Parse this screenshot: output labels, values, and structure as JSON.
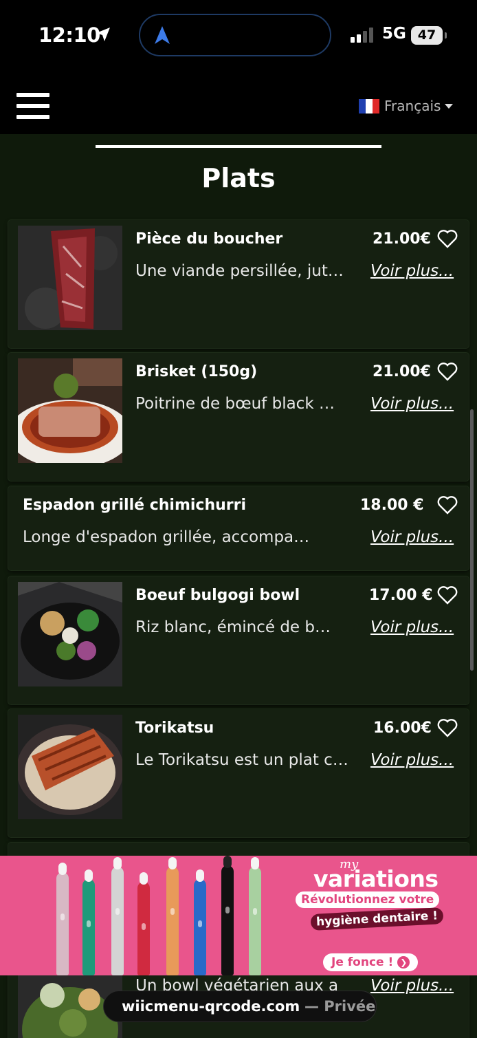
{
  "status_bar": {
    "time": "12:10",
    "network": "5G",
    "battery": "47"
  },
  "nav": {
    "language": "Français"
  },
  "section": {
    "title": "Plats"
  },
  "items": [
    {
      "name": "Pièce du boucher",
      "description": "Une viande persillée, juteuse et tendre",
      "price": "21.00€",
      "more": "Voir plus..."
    },
    {
      "name": "Brisket (150g)",
      "description": "Poitrine de bœuf black Angus fumée",
      "price": "21.00€",
      "more": "Voir plus..."
    },
    {
      "name": "Espadon grillé chimichurri",
      "description": "Longe d'espadon grillée, accompagnée de sauce chimichurri",
      "price": "18.00 €",
      "more": "Voir plus..."
    },
    {
      "name": "Boeuf bulgogi bowl",
      "description": "Riz blanc, émincé de bœuf mariné",
      "price": "17.00 €",
      "more": "Voir plus..."
    },
    {
      "name": "Torikatsu",
      "description": "Le Torikatsu est un plat croustillant",
      "price": "16.00€",
      "more": "Voir plus..."
    },
    {
      "description": "Un bowl végétarien aux a",
      "more": "Voir plus..."
    }
  ],
  "ad": {
    "brand_top": "my",
    "brand": "variations",
    "line1": "Révolutionnez votre",
    "line2": "hygiène dentaire !",
    "cta": "Je fonce !"
  },
  "browser": {
    "host": "wiicmenu-qrcode.com",
    "mode": "— Privée"
  }
}
